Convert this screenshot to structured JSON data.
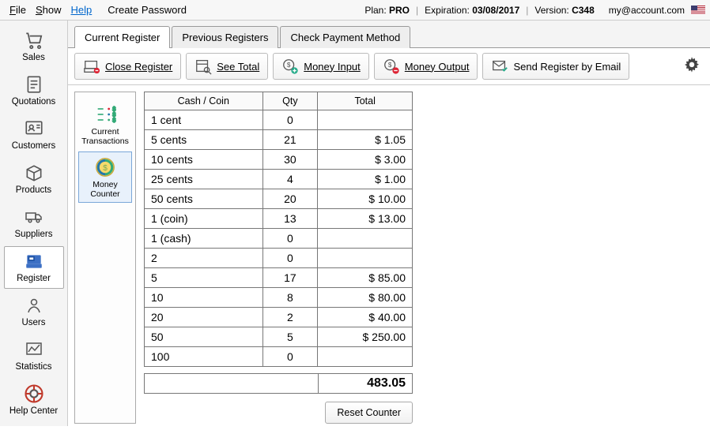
{
  "menubar": {
    "file": "File",
    "show": "Show",
    "help": "Help",
    "create_password": "Create Password",
    "plan_label": "Plan:",
    "plan_value": "PRO",
    "exp_label": "Expiration:",
    "exp_value": "03/08/2017",
    "ver_label": "Version:",
    "ver_value": "C348",
    "account": "my@account.com"
  },
  "sidenav": {
    "items": [
      {
        "label": "Sales"
      },
      {
        "label": "Quotations"
      },
      {
        "label": "Customers"
      },
      {
        "label": "Products"
      },
      {
        "label": "Suppliers"
      },
      {
        "label": "Register"
      },
      {
        "label": "Users"
      },
      {
        "label": "Statistics"
      },
      {
        "label": "Help Center"
      }
    ],
    "active_index": 5
  },
  "tabs": {
    "items": [
      {
        "label": "Current Register"
      },
      {
        "label": "Previous Registers"
      },
      {
        "label": "Check Payment Method"
      }
    ],
    "active_index": 0
  },
  "toolbar": {
    "close_register": "Close Register",
    "see_total": "See Total",
    "money_input": "Money Input",
    "money_output": "Money Output",
    "send_email": "Send Register by Email"
  },
  "subnav": {
    "items": [
      {
        "label": "Current Transactions"
      },
      {
        "label": "Money Counter"
      }
    ],
    "active_index": 1
  },
  "table": {
    "headers": {
      "cash": "Cash / Coin",
      "qty": "Qty",
      "total": "Total"
    },
    "rows": [
      {
        "name": "1 cent",
        "qty": "0",
        "total": ""
      },
      {
        "name": "5 cents",
        "qty": "21",
        "total": "$ 1.05"
      },
      {
        "name": "10 cents",
        "qty": "30",
        "total": "$ 3.00"
      },
      {
        "name": "25 cents",
        "qty": "4",
        "total": "$ 1.00"
      },
      {
        "name": "50 cents",
        "qty": "20",
        "total": "$ 10.00"
      },
      {
        "name": "1 (coin)",
        "qty": "13",
        "total": "$ 13.00"
      },
      {
        "name": "1 (cash)",
        "qty": "0",
        "total": ""
      },
      {
        "name": "2",
        "qty": "0",
        "total": ""
      },
      {
        "name": "5",
        "qty": "17",
        "total": "$ 85.00"
      },
      {
        "name": "10",
        "qty": "8",
        "total": "$ 80.00"
      },
      {
        "name": "20",
        "qty": "2",
        "total": "$ 40.00"
      },
      {
        "name": "50",
        "qty": "5",
        "total": "$ 250.00"
      },
      {
        "name": "100",
        "qty": "0",
        "total": ""
      }
    ],
    "grand_total": "483.05",
    "reset_label": "Reset Counter"
  }
}
